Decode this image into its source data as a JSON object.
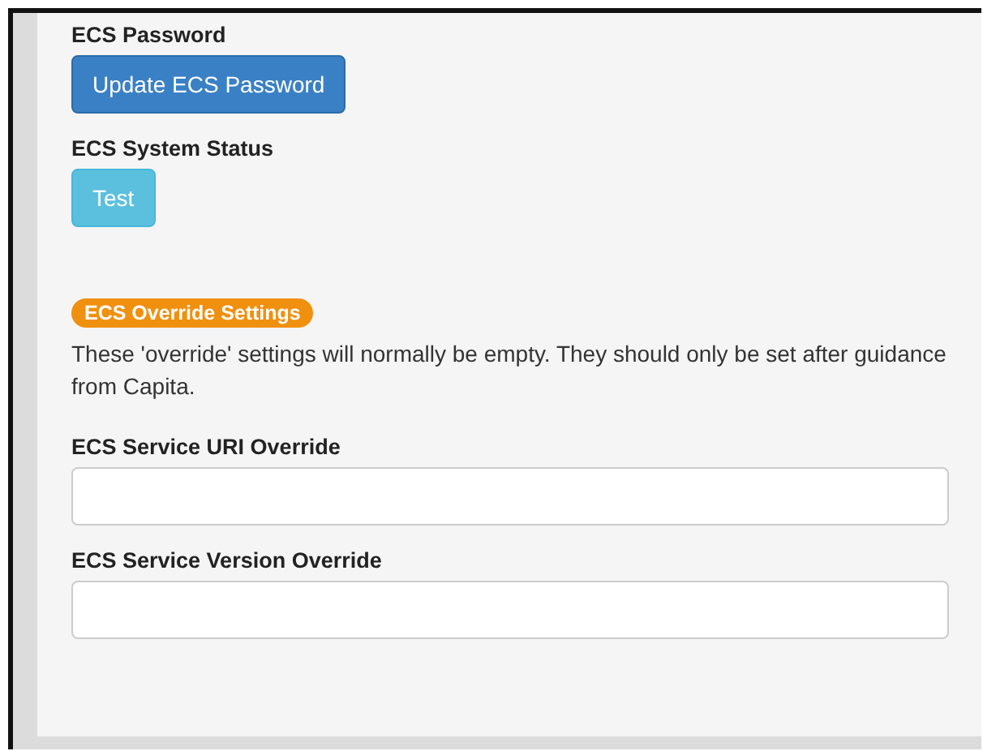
{
  "sections": [
    {
      "label": "ECS Password",
      "button": {
        "text": "Update ECS Password",
        "kind": "primary"
      }
    },
    {
      "label": "ECS System Status",
      "button": {
        "text": "Test",
        "kind": "info"
      }
    }
  ],
  "badge": "ECS Override Settings",
  "note": "These 'override' settings will normally be empty. They should only be set after guidance from Capita.",
  "fields": [
    {
      "label": "ECS Service URI Override"
    },
    {
      "label": "ECS Service Version Override"
    }
  ]
}
